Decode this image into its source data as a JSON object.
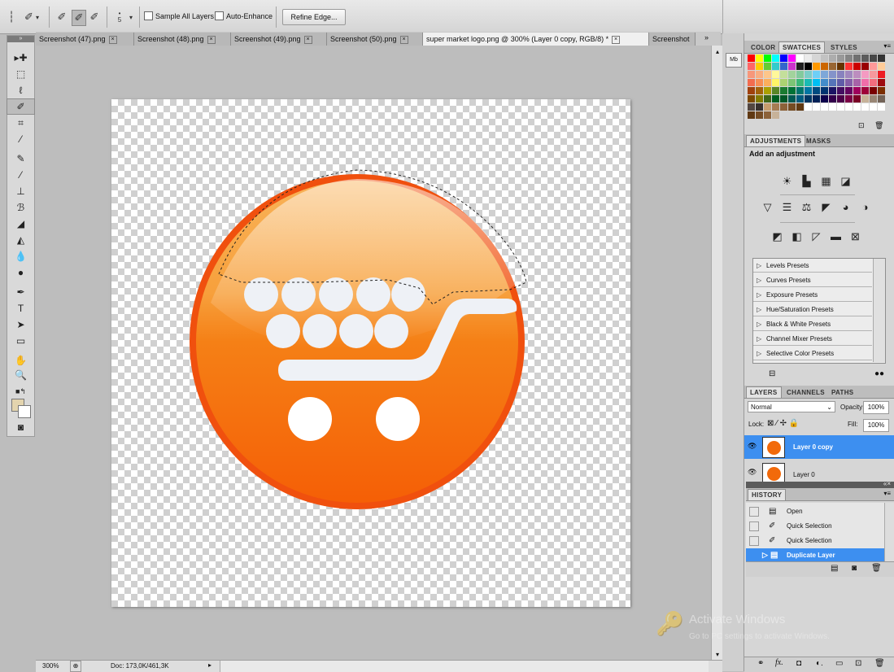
{
  "options": {
    "brush_size": "5",
    "sample_all_layers_label": "Sample All Layers",
    "auto_enhance_label": "Auto-Enhance",
    "refine_edge_label": "Refine Edge..."
  },
  "tabs": [
    {
      "label": "Screenshot (47).png"
    },
    {
      "label": "Screenshot (48).png"
    },
    {
      "label": "Screenshot (49).png"
    },
    {
      "label": "Screenshot (50).png"
    },
    {
      "label": "super market logo.png @ 300% (Layer 0 copy, RGB/8) *"
    },
    {
      "label": "Screenshot"
    }
  ],
  "status": {
    "zoom": "300%",
    "doc": "Doc: 173,0K/461,3K"
  },
  "swatches_panel": {
    "tabs": [
      "COLOR",
      "SWATCHES",
      "STYLES"
    ]
  },
  "adjustments_panel": {
    "tabs": [
      "ADJUSTMENTS",
      "MASKS"
    ],
    "heading": "Add an adjustment",
    "presets": [
      "Levels Presets",
      "Curves Presets",
      "Exposure Presets",
      "Hue/Saturation Presets",
      "Black & White Presets",
      "Channel Mixer Presets",
      "Selective Color Presets"
    ]
  },
  "layers_panel": {
    "tabs": [
      "LAYERS",
      "CHANNELS",
      "PATHS"
    ],
    "blend_mode": "Normal",
    "opacity_label": "Opacity:",
    "opacity": "100%",
    "lock_label": "Lock:",
    "fill_label": "Fill:",
    "fill": "100%",
    "layers": [
      {
        "name": "Layer 0 copy",
        "selected": true
      },
      {
        "name": "Layer 0",
        "selected": false
      }
    ]
  },
  "history_panel": {
    "title": "HISTORY",
    "items": [
      {
        "label": "Open"
      },
      {
        "label": "Quick Selection"
      },
      {
        "label": "Quick Selection"
      },
      {
        "label": "Duplicate Layer"
      }
    ]
  },
  "watermark": {
    "line1": "Activate Windows",
    "line2": "Go to PC settings to activate Windows."
  },
  "colors": {
    "accent_selected": "#3d8ff0",
    "logo_orange": "#f26a0a",
    "logo_ring": "#f04e0d"
  }
}
